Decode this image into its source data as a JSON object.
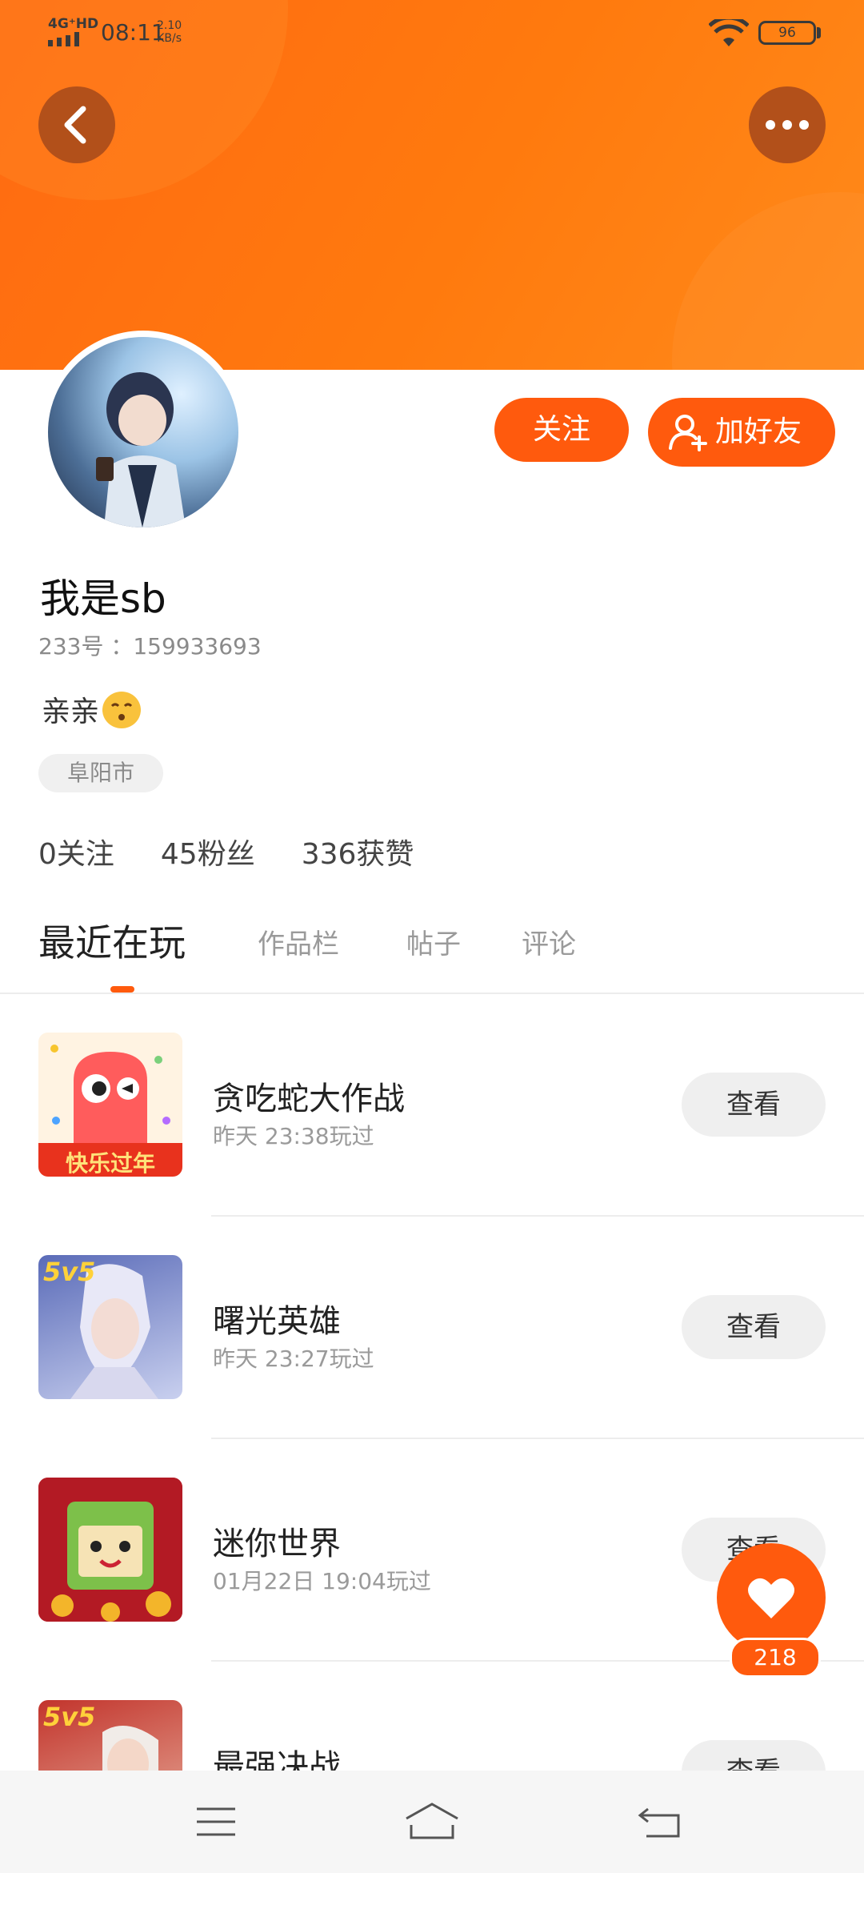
{
  "status_bar": {
    "network": "4G⁺HD",
    "time": "08:11",
    "speed_value": "2.10",
    "speed_unit": "KB/s",
    "battery": "96"
  },
  "header": {
    "back_icon": "chevron-left-icon",
    "more_icon": "more-dots-icon",
    "accent_color": "#ff6a12"
  },
  "actions": {
    "follow": "关注",
    "add_friend": "加好友"
  },
  "profile": {
    "name": "我是sb",
    "uid": "233号 ：159933693",
    "bio": "亲亲",
    "location": "阜阳市"
  },
  "stats": {
    "following": "0关注",
    "fans": "45粉丝",
    "likes": "336获赞"
  },
  "tabs": [
    "最近在玩",
    "作品栏",
    "帖子",
    "评论"
  ],
  "games": [
    {
      "title": "贪吃蛇大作战",
      "time": "昨天 23:38玩过",
      "button": "查看",
      "badge": "快乐过年"
    },
    {
      "title": "曙光英雄",
      "time": "昨天 23:27玩过",
      "button": "查看",
      "badge": "5v5"
    },
    {
      "title": "迷你世界",
      "time": "01月22日 19:04玩过",
      "button": "查看"
    },
    {
      "title": "最强决战",
      "time": "",
      "button": "查看",
      "badge": "5v5"
    }
  ],
  "floating_like": {
    "count": "218"
  },
  "nav": {
    "menu_icon": "menu-icon",
    "home_icon": "home-icon",
    "back_icon": "back-icon"
  }
}
